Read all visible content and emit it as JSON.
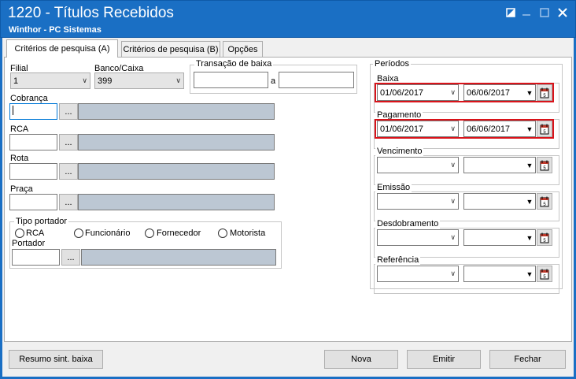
{
  "window": {
    "title": "1220 - Títulos Recebidos",
    "subtitle": "Winthor - PC Sistemas"
  },
  "tabs": [
    {
      "label": "Critérios de pesquisa (A)",
      "active": true
    },
    {
      "label": "Critérios de pesquisa (B)",
      "active": false
    },
    {
      "label": "Opções",
      "active": false
    }
  ],
  "left": {
    "filial": {
      "label": "Filial",
      "value": "1"
    },
    "banco_caixa": {
      "label": "Banco/Caixa",
      "value": "399"
    },
    "transacao": {
      "label": "Transação de baixa",
      "separator": "a",
      "from": "",
      "to": ""
    },
    "cobranca": {
      "label": "Cobrança",
      "button": "..."
    },
    "rca": {
      "label": "RCA",
      "button": "..."
    },
    "rota": {
      "label": "Rota",
      "button": "..."
    },
    "praca": {
      "label": "Praça",
      "button": "..."
    },
    "tipo_portador": {
      "label": "Tipo portador",
      "options": [
        "RCA",
        "Funcionário",
        "Fornecedor",
        "Motorista"
      ],
      "portador_label": "Portador",
      "button": "..."
    }
  },
  "periodos": {
    "label": "Períodos",
    "groups": [
      {
        "label": "Baixa",
        "from": "01/06/2017",
        "to": "06/06/2017",
        "highlighted": true
      },
      {
        "label": "Pagamento",
        "from": "01/06/2017",
        "to": "06/06/2017",
        "highlighted": true
      },
      {
        "label": "Vencimento",
        "from": "",
        "to": "",
        "highlighted": false
      },
      {
        "label": "Emissão",
        "from": "",
        "to": "",
        "highlighted": false
      },
      {
        "label": "Desdobramento",
        "from": "",
        "to": "",
        "highlighted": false
      },
      {
        "label": "Referência",
        "from": "",
        "to": "",
        "highlighted": false
      }
    ]
  },
  "buttons": {
    "resumo": "Resumo sint. baixa",
    "nova": "Nova",
    "emitir": "Emitir",
    "fechar": "Fechar"
  },
  "colors": {
    "titlebar": "#1a6fc4",
    "highlight": "#d9131a",
    "readonly_field": "#bcc7d3"
  }
}
